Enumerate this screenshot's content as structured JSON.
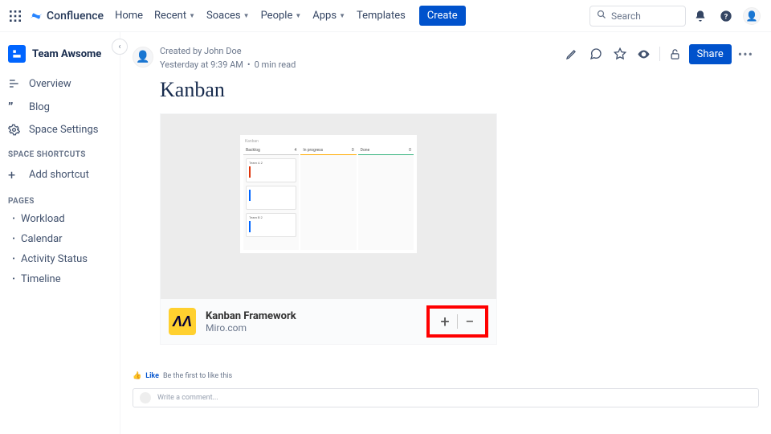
{
  "topnav": {
    "product": "Confluence",
    "items": [
      "Home",
      "Recent",
      "Soaces",
      "People",
      "Apps",
      "Templates"
    ],
    "items_has_chevron": [
      false,
      true,
      true,
      true,
      true,
      false
    ],
    "create": "Create",
    "search_placeholder": "Search"
  },
  "sidebar": {
    "space_name": "Team Awsome",
    "nav": [
      {
        "icon": "overview",
        "label": "Overview"
      },
      {
        "icon": "blog",
        "label": "Blog"
      },
      {
        "icon": "settings",
        "label": "Space Settings"
      }
    ],
    "shortcuts_heading": "SPACE SHORTCUTS",
    "add_shortcut": "Add shortcut",
    "pages_heading": "PAGES",
    "pages": [
      "Workload",
      "Calendar",
      "Activity Status",
      "Timeline"
    ]
  },
  "page": {
    "created_by_prefix": "Created by ",
    "author": "John Doe",
    "timestamp": "Yesterday at 9:39 AM",
    "readtime": "0 min read",
    "title": "Kanban",
    "share": "Share"
  },
  "embed": {
    "board_label": "Kanban",
    "columns": [
      {
        "title": "Backlog",
        "count": "4"
      },
      {
        "title": "In progress",
        "count": "0"
      },
      {
        "title": "Done",
        "count": "0"
      }
    ],
    "cards_col0": [
      {
        "label": "Team A",
        "count": "2"
      },
      {
        "label": "Team B",
        "count": "2"
      }
    ],
    "title": "Kanban Framework",
    "source": "Miro.com"
  },
  "footer": {
    "like": "Like",
    "first": "Be the first to like this",
    "comment_placeholder": "Write a comment..."
  }
}
